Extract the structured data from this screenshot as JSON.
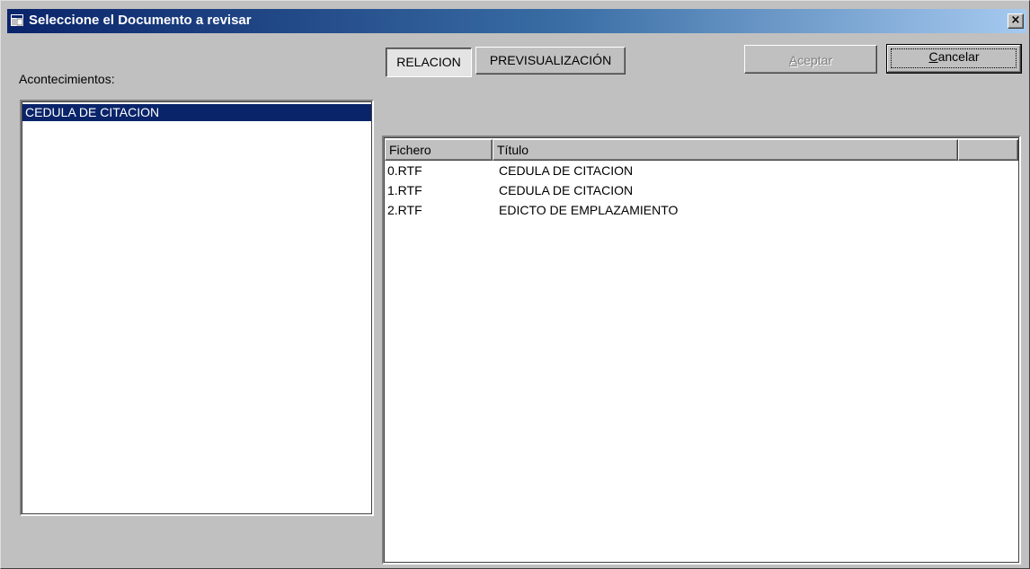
{
  "window": {
    "title": "Seleccione el Documento a revisar",
    "close_glyph": "×"
  },
  "left_panel": {
    "label": "Acontecimientos:",
    "items": [
      "CEDULA DE CITACION"
    ],
    "selected_index": 0
  },
  "tabs": {
    "relacion": "RELACION",
    "previsualizacion": "PREVISUALIZACIÓN"
  },
  "buttons": {
    "aceptar_prefix": "A",
    "aceptar_rest": "ceptar",
    "cancelar_prefix": "C",
    "cancelar_rest": "ancelar"
  },
  "listview": {
    "columns": [
      "Fichero",
      "Título",
      ""
    ],
    "rows": [
      {
        "fichero": "0.RTF",
        "titulo": "CEDULA DE CITACION"
      },
      {
        "fichero": "1.RTF",
        "titulo": "CEDULA DE CITACION"
      },
      {
        "fichero": "2.RTF",
        "titulo": "EDICTO DE EMPLAZAMIENTO"
      }
    ]
  },
  "colors": {
    "title_start": "#0a246a",
    "title_end": "#a6caf0",
    "face": "#c0c0c0",
    "selection": "#0a246a"
  },
  "icons": {
    "title": "window-app-icon",
    "close": "close-icon"
  }
}
